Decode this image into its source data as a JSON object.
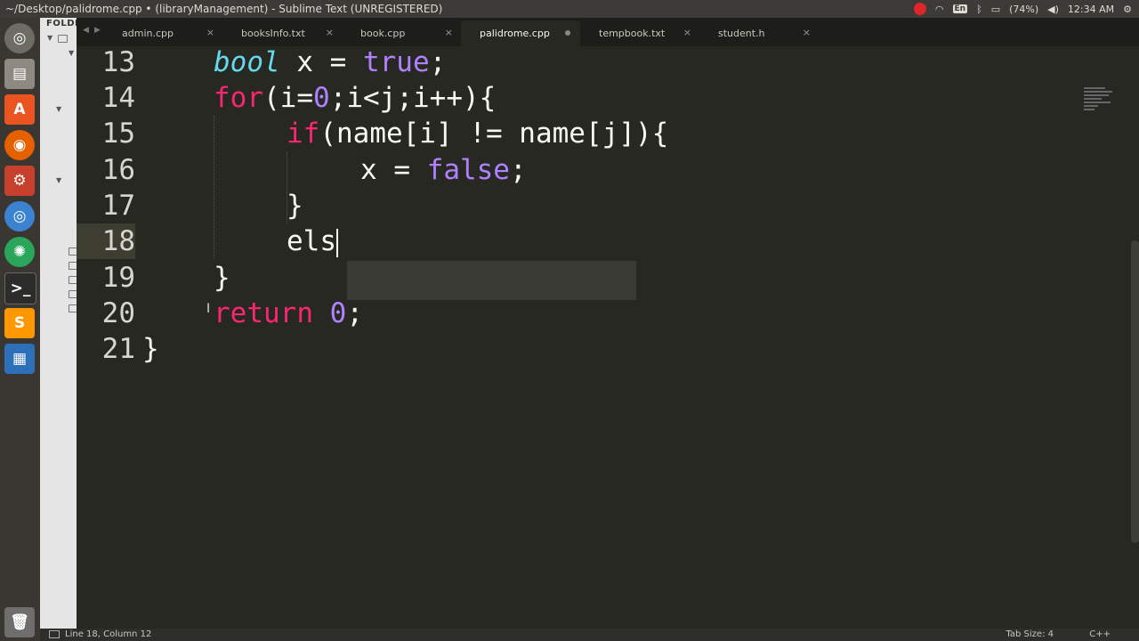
{
  "window": {
    "title": "~/Desktop/palidrome.cpp • (libraryManagement) - Sublime Text (UNREGISTERED)"
  },
  "tray": {
    "keyboard": "En",
    "battery": "(74%)",
    "time": "12:34 AM"
  },
  "sidebar": {
    "header": "FOLDE"
  },
  "tabs": [
    {
      "label": "admin.cpp",
      "state": "close"
    },
    {
      "label": "booksInfo.txt",
      "state": "close"
    },
    {
      "label": "book.cpp",
      "state": "close"
    },
    {
      "label": "palidrome.cpp",
      "state": "modified",
      "active": true
    },
    {
      "label": "tempbook.txt",
      "state": "close"
    },
    {
      "label": "student.h",
      "state": "close"
    }
  ],
  "tab_close_glyph": "×",
  "editor": {
    "line_numbers": [
      "13",
      "14",
      "15",
      "16",
      "17",
      "18",
      "19",
      "20",
      "21"
    ],
    "current_line": "18",
    "code": {
      "l13_type": "bool",
      "l13_rest": " x = ",
      "l13_val": "true",
      "l13_end": ";",
      "l14_kw": "for",
      "l14_a": "(i=",
      "l14_n1": "0",
      "l14_b": ";i<j;i++){",
      "l15_kw": "if",
      "l15_rest": "(name[i] != name[j]){",
      "l16_a": "x = ",
      "l16_val": "false",
      "l16_end": ";",
      "l17": "}",
      "l18": "els",
      "l19": "}",
      "l20_kw": "return",
      "l20_sp": " ",
      "l20_n": "0",
      "l20_end": ";",
      "l21": "}"
    }
  },
  "statusbar": {
    "position": "Line 18, Column 12",
    "tab_size": "Tab Size: 4",
    "syntax": "C++"
  },
  "colors": {
    "keyword": "#f92672",
    "type": "#66d9ef",
    "constant": "#ae81ff",
    "background": "#272822"
  }
}
